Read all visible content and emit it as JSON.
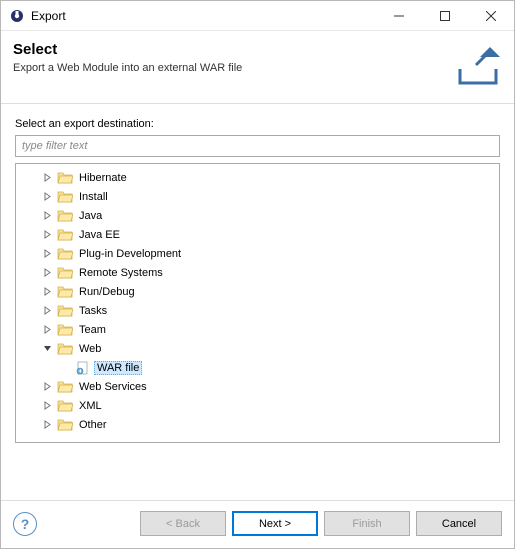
{
  "titlebar": {
    "title": "Export"
  },
  "header": {
    "title": "Select",
    "description": "Export a Web Module into an external WAR file"
  },
  "body": {
    "destination_label": "Select an export destination:",
    "filter_placeholder": "type filter text"
  },
  "tree": {
    "items": [
      {
        "label": "Hibernate",
        "expanded": false,
        "depth": 1,
        "type": "folder"
      },
      {
        "label": "Install",
        "expanded": false,
        "depth": 1,
        "type": "folder"
      },
      {
        "label": "Java",
        "expanded": false,
        "depth": 1,
        "type": "folder"
      },
      {
        "label": "Java EE",
        "expanded": false,
        "depth": 1,
        "type": "folder"
      },
      {
        "label": "Plug-in Development",
        "expanded": false,
        "depth": 1,
        "type": "folder"
      },
      {
        "label": "Remote Systems",
        "expanded": false,
        "depth": 1,
        "type": "folder"
      },
      {
        "label": "Run/Debug",
        "expanded": false,
        "depth": 1,
        "type": "folder"
      },
      {
        "label": "Tasks",
        "expanded": false,
        "depth": 1,
        "type": "folder"
      },
      {
        "label": "Team",
        "expanded": false,
        "depth": 1,
        "type": "folder"
      },
      {
        "label": "Web",
        "expanded": true,
        "depth": 1,
        "type": "folder"
      },
      {
        "label": "WAR file",
        "expanded": null,
        "depth": 2,
        "type": "file",
        "selected": true
      },
      {
        "label": "Web Services",
        "expanded": false,
        "depth": 1,
        "type": "folder"
      },
      {
        "label": "XML",
        "expanded": false,
        "depth": 1,
        "type": "folder"
      },
      {
        "label": "Other",
        "expanded": false,
        "depth": 1,
        "type": "folder"
      }
    ]
  },
  "footer": {
    "back": "< Back",
    "next": "Next >",
    "finish": "Finish",
    "cancel": "Cancel"
  }
}
